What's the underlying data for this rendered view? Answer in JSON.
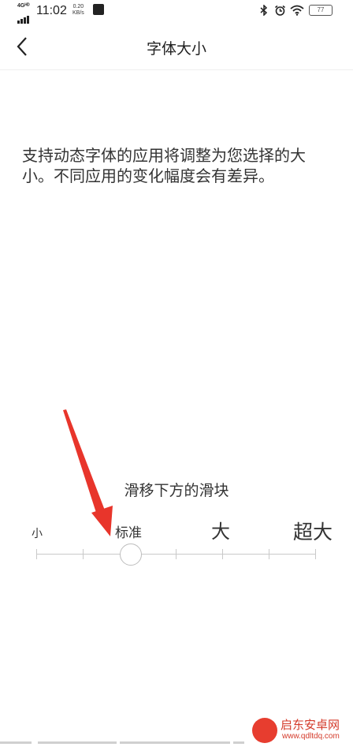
{
  "status_bar": {
    "network": "4Gᴴᴰ",
    "time": "11:02",
    "speed_value": "0.20",
    "speed_unit": "KB/s",
    "battery": "77",
    "icons": [
      "bluetooth-icon",
      "alarm-icon",
      "wifi-icon",
      "battery-icon"
    ]
  },
  "nav": {
    "title": "字体大小",
    "back_icon": "chevron-left-icon"
  },
  "description": "支持动态字体的应用将调整为您选择的大小。不同应用的变化幅度会有差异。",
  "slider": {
    "hint": "滑移下方的滑块",
    "labels": [
      "小",
      "标准",
      "大",
      "超大"
    ],
    "selected_index": 1,
    "step_count": 6
  },
  "annotation": {
    "arrow_color": "#e8352b"
  },
  "watermark": {
    "title": "启东安卓网",
    "url": "www.qdltdq.com"
  }
}
